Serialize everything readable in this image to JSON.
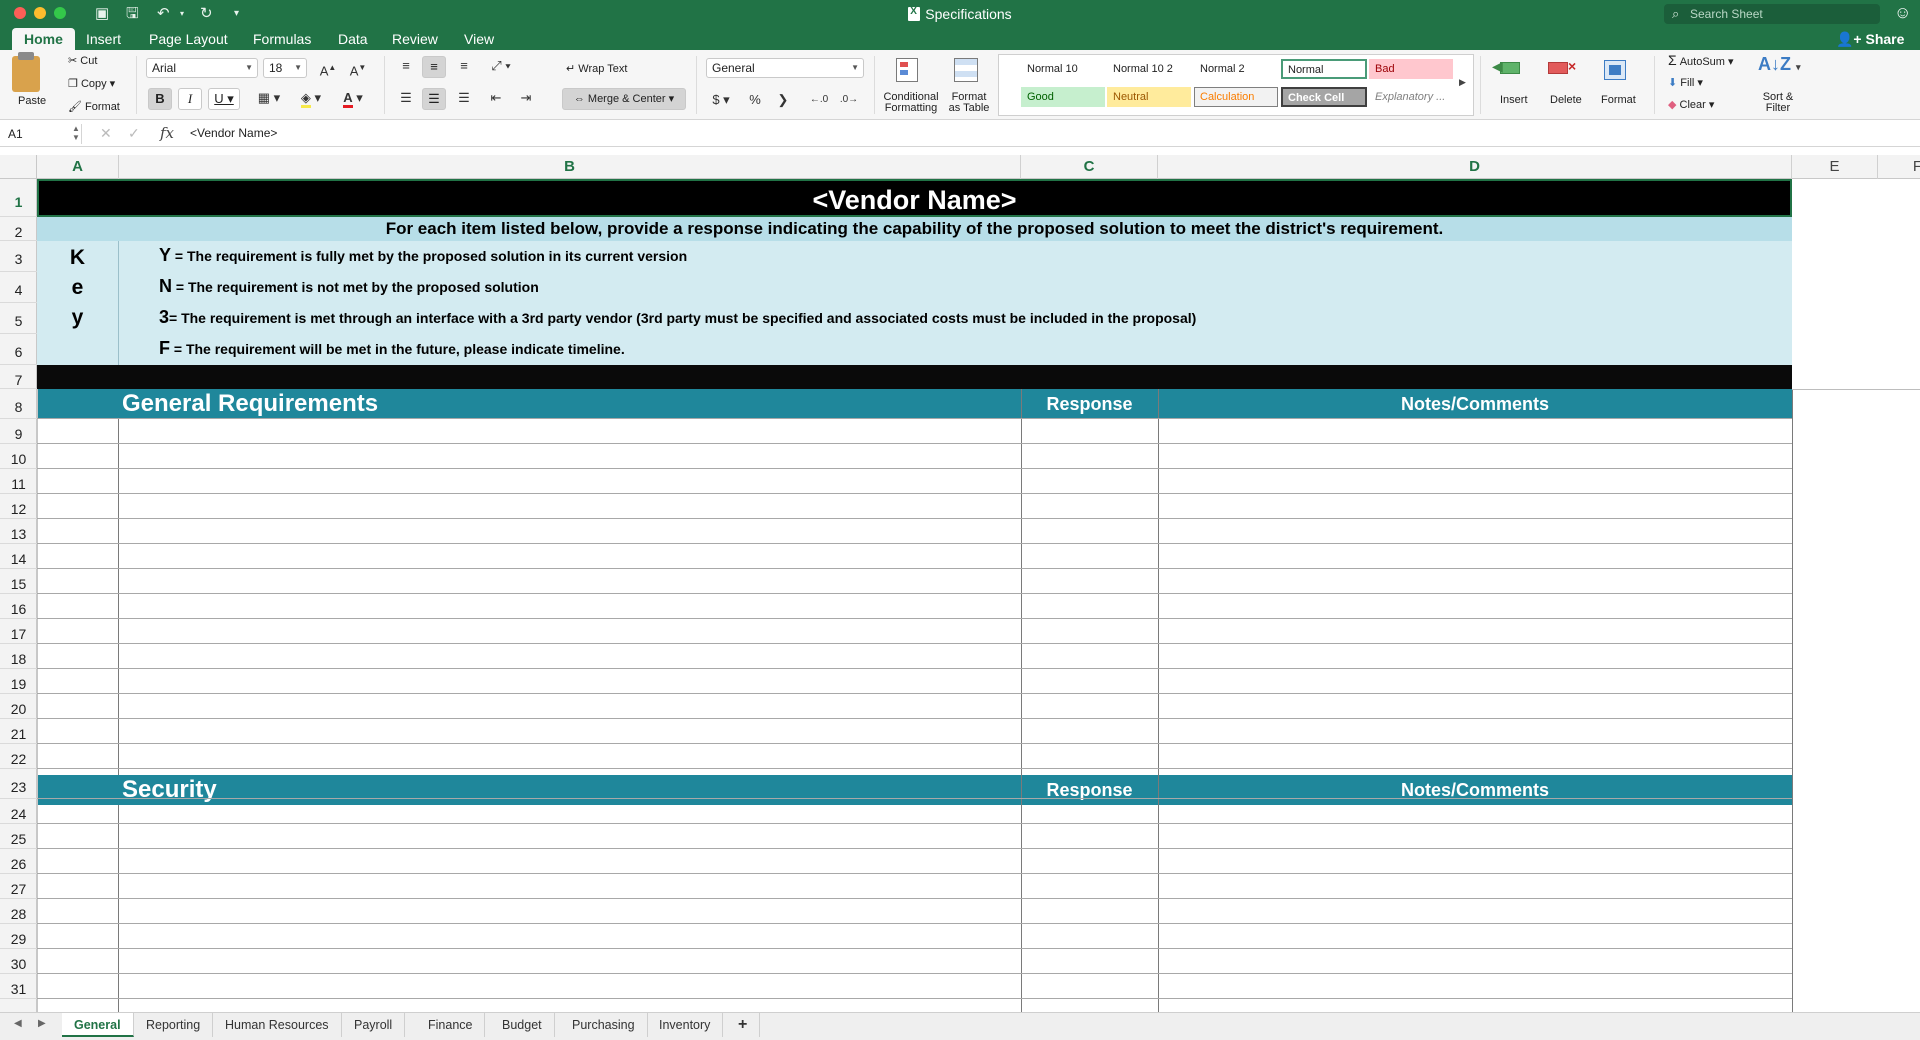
{
  "window": {
    "title": "Specifications"
  },
  "search": {
    "placeholder": "Search Sheet"
  },
  "share_label": "Share",
  "ribbon_tabs": [
    {
      "label": "Home"
    },
    {
      "label": "Insert"
    },
    {
      "label": "Page Layout"
    },
    {
      "label": "Formulas"
    },
    {
      "label": "Data"
    },
    {
      "label": "Review"
    },
    {
      "label": "View"
    }
  ],
  "clipboard": {
    "paste": "Paste",
    "cut": "Cut",
    "copy": "Copy",
    "format": "Format"
  },
  "font": {
    "name": "Arial",
    "size": "18"
  },
  "alignment": {
    "wrap": "Wrap Text",
    "merge": "Merge & Center"
  },
  "number": {
    "format": "General"
  },
  "styles": {
    "conditional": "Conditional Formatting",
    "cond_l1": "Conditional",
    "cond_l2": "Formatting",
    "as_table_l1": "Format",
    "as_table_l2": "as Table",
    "gallery": [
      {
        "label": "Normal 10"
      },
      {
        "label": "Normal 10 2"
      },
      {
        "label": "Normal 2"
      },
      {
        "label": "Normal"
      },
      {
        "label": "Bad"
      },
      {
        "label": "Good"
      },
      {
        "label": "Neutral"
      },
      {
        "label": "Calculation"
      },
      {
        "label": "Check Cell"
      },
      {
        "label": "Explanatory ..."
      }
    ]
  },
  "cells_group": {
    "insert": "Insert",
    "delete": "Delete",
    "format": "Format"
  },
  "editing": {
    "autosum": "AutoSum",
    "fill": "Fill",
    "clear": "Clear",
    "sort_l1": "Sort &",
    "sort_l2": "Filter"
  },
  "formula_bar": {
    "cell_ref": "A1",
    "content": "<Vendor Name>"
  },
  "columns": [
    {
      "label": "A"
    },
    {
      "label": "B"
    },
    {
      "label": "C"
    },
    {
      "label": "D"
    },
    {
      "label": "E"
    },
    {
      "label": "F"
    }
  ],
  "rows": [
    "1",
    "2",
    "3",
    "4",
    "5",
    "6",
    "7",
    "8",
    "9",
    "10",
    "11",
    "12",
    "13",
    "14",
    "15",
    "16",
    "17",
    "18",
    "19",
    "20",
    "21",
    "22",
    "23",
    "24",
    "25",
    "26",
    "27",
    "28",
    "29",
    "30",
    "31"
  ],
  "sheet": {
    "title": "<Vendor Name>",
    "instruction": "For each item listed below, provide a response indicating the capability of the proposed solution to meet the district's requirement.",
    "key_letters": [
      "K",
      "e",
      "y"
    ],
    "key_items": [
      {
        "code": "Y",
        "text": " = The requirement is fully met by the proposed solution in its current version"
      },
      {
        "code": "N",
        "text": " = The requirement is not met by the proposed solution"
      },
      {
        "code": "3",
        "text": "= The requirement is met through an interface with a 3rd party vendor  (3rd party must be specified  and associated costs must be included in the proposal)"
      },
      {
        "code": "F",
        "text": " = The requirement will be met in the future, please indicate timeline."
      }
    ],
    "sections": [
      {
        "title": "General Requirements",
        "response": "Response",
        "notes": "Notes/Comments"
      },
      {
        "title": "Security",
        "response": "Response",
        "notes": "Notes/Comments"
      }
    ]
  },
  "sheet_tabs": [
    {
      "label": "General"
    },
    {
      "label": "Reporting"
    },
    {
      "label": "Human Resources"
    },
    {
      "label": "Payroll"
    },
    {
      "label": "Finance"
    },
    {
      "label": "Budget"
    },
    {
      "label": "Purchasing"
    },
    {
      "label": "Inventory"
    }
  ],
  "colors": {
    "excel_green": "#217346",
    "teal_header": "#1f879b",
    "key_bg": "#d3ebf1",
    "instr_bg": "#b7dee8"
  }
}
